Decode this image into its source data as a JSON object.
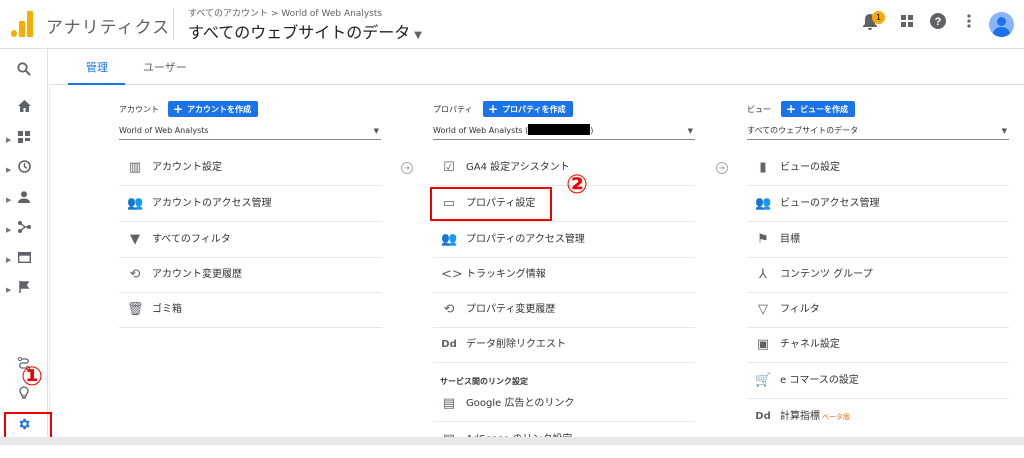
{
  "header": {
    "app_title": "アナリティクス",
    "breadcrumb": "すべてのアカウント > World of Web Analysts",
    "property": "すべてのウェブサイトのデータ",
    "notification_count": "1",
    "logo_color": "#f9ab00"
  },
  "tabs": [
    {
      "label": "管理"
    },
    {
      "label": "ユーザー"
    }
  ],
  "account": {
    "heading": "アカウント",
    "create_label": "アカウントを作成",
    "selected": "World of Web Analysts",
    "items": [
      {
        "label": "アカウント設定",
        "icon": "building-icon"
      },
      {
        "label": "アカウントのアクセス管理",
        "icon": "people-icon"
      },
      {
        "label": "すべてのフィルタ",
        "icon": "filter-icon"
      },
      {
        "label": "アカウント変更履歴",
        "icon": "history-icon"
      },
      {
        "label": "ゴミ箱",
        "icon": "trash-icon"
      }
    ]
  },
  "property": {
    "heading": "プロパティ",
    "create_label": "プロパティを作成",
    "selected_prefix": "World of Web Analysts (",
    "selected_suffix": ")",
    "items": [
      {
        "label": "GA4 設定アシスタント",
        "icon": "checkbox-icon"
      },
      {
        "label": "プロパティ設定",
        "icon": "property-icon"
      },
      {
        "label": "プロパティのアクセス管理",
        "icon": "people-icon"
      },
      {
        "label": "トラッキング情報",
        "icon": "code-icon"
      },
      {
        "label": "プロパティ変更履歴",
        "icon": "history-icon"
      },
      {
        "label": "データ削除リクエスト",
        "icon": "dd-icon",
        "glyph": "Dd"
      }
    ],
    "section_label": "サービス間のリンク設定",
    "link_items": [
      {
        "label": "Google 広告とのリンク",
        "icon": "ads-icon"
      },
      {
        "label": "AdSense のリンク設定",
        "icon": "adsense-icon"
      }
    ]
  },
  "view": {
    "heading": "ビュー",
    "create_label": "ビューを作成",
    "selected": "すべてのウェブサイトのデータ",
    "items": [
      {
        "label": "ビューの設定",
        "icon": "document-icon"
      },
      {
        "label": "ビューのアクセス管理",
        "icon": "people-icon"
      },
      {
        "label": "目標",
        "icon": "flag-icon"
      },
      {
        "label": "コンテンツ グループ",
        "icon": "content-group-icon"
      },
      {
        "label": "フィルタ",
        "icon": "filter-icon"
      },
      {
        "label": "チャネル設定",
        "icon": "channel-icon"
      },
      {
        "label": "e コマースの設定",
        "icon": "cart-icon"
      },
      {
        "label": "計算指標",
        "icon": "dd-icon",
        "glyph": "Dd",
        "badge": "ベータ版"
      }
    ]
  },
  "annotations": {
    "one": "①",
    "two": "②"
  },
  "colors": {
    "accent": "#1a73e8",
    "annotation": "#ee0000"
  }
}
